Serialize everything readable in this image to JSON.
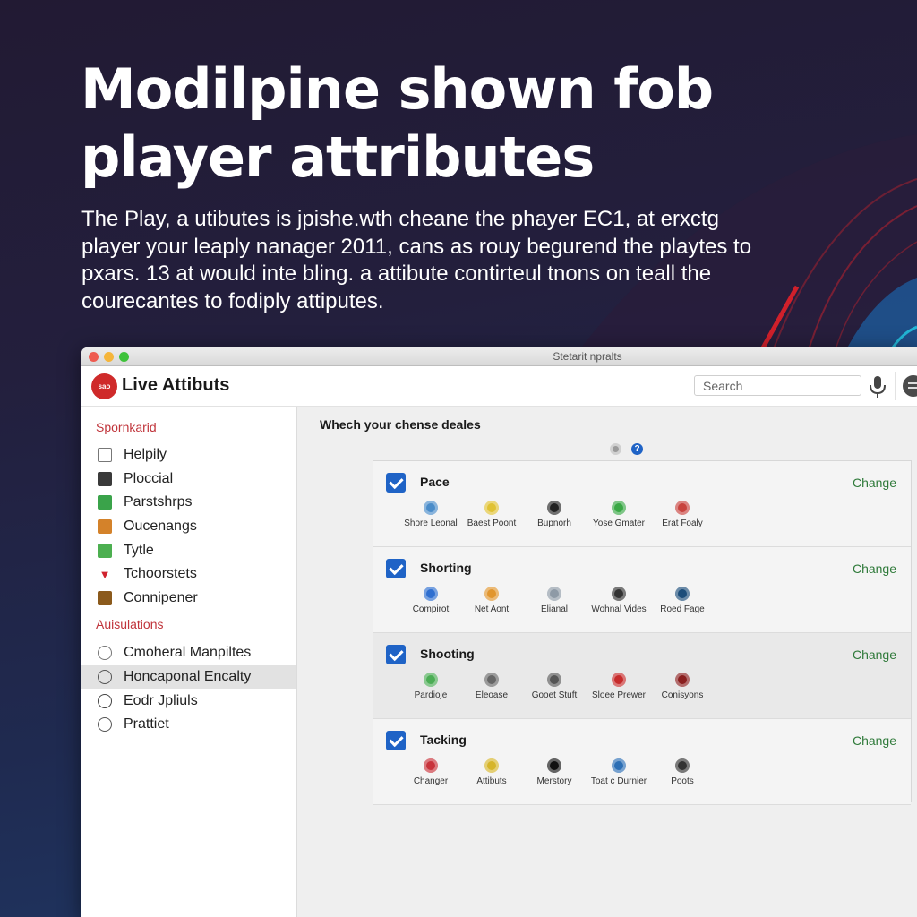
{
  "hero": {
    "headline_line1": "Modilpine shown fob",
    "headline_line2": "player attributes",
    "intro": "The Play, a utibutes is jpishe.wth cheane the phayer EC1, at erxctg player your leaply nanager 2011, cans as rouy begurend the playtes to pxars. 13 at would inte bling. a attibute contirteul tnons on teall the courecantes to fodiply attiputes."
  },
  "window": {
    "title": "Stetarit npralts",
    "app_name": "Live Attibuts",
    "logo_text": "sao",
    "search_placeholder": "Search",
    "icons": {
      "mic": "microphone-icon",
      "settings": "settings-icon"
    }
  },
  "sidebar": {
    "sections": [
      {
        "heading": "Spornkarid",
        "items": [
          {
            "label": "Helpily",
            "icon": "document-icon",
            "color": "#777777"
          },
          {
            "label": "Ploccial",
            "icon": "seat-icon",
            "color": "#3a3a3a"
          },
          {
            "label": "Parstshrps",
            "icon": "home-icon",
            "color": "#3aa34a"
          },
          {
            "label": "Oucenangs",
            "icon": "shield-icon",
            "color": "#d4822a"
          },
          {
            "label": "Tytle",
            "icon": "chart-icon",
            "color": "#4caf50"
          },
          {
            "label": "Tchoorstets",
            "icon": "check-mark-icon",
            "color": "#d0232f"
          },
          {
            "label": "Connipener",
            "icon": "triangle-icon",
            "color": "#8b5a1c"
          }
        ]
      },
      {
        "heading": "Auisulations",
        "items": [
          {
            "label": "Cmoheral Manpiltes",
            "icon": "user-icon",
            "color": "#777777",
            "active": false
          },
          {
            "label": "Honcaponal Encalty",
            "icon": "columns-icon",
            "color": "#555555",
            "active": true
          },
          {
            "label": "Eodr Jpliuls",
            "icon": "location-icon",
            "color": "#444444",
            "active": false
          },
          {
            "label": "Prattiet",
            "icon": "house-icon",
            "color": "#555555",
            "active": false
          }
        ]
      }
    ]
  },
  "main": {
    "title": "Whech your chense deales",
    "toolbar_icons": [
      "refresh-icon",
      "help-icon"
    ],
    "change_label": "Change",
    "cards": [
      {
        "title": "Pace",
        "checked": true,
        "attributes": [
          {
            "label": "Shore Leonal",
            "color": "#4a8cc9"
          },
          {
            "label": "Baest Poont",
            "color": "#e0c233"
          },
          {
            "label": "Bupnorh",
            "color": "#222222"
          },
          {
            "label": "Yose Gmater",
            "color": "#3aa845"
          },
          {
            "label": "Erat Foaly",
            "color": "#c8433e"
          }
        ]
      },
      {
        "title": "Shorting",
        "checked": true,
        "attributes": [
          {
            "label": "Compirot",
            "color": "#2f6fd0"
          },
          {
            "label": "Net Aont",
            "color": "#e1962f"
          },
          {
            "label": "Elianal",
            "color": "#8e9aa6"
          },
          {
            "label": "Wohnal Vides",
            "color": "#333333"
          },
          {
            "label": "Roed Fage",
            "color": "#1c4d7a"
          }
        ]
      },
      {
        "title": "Shooting",
        "checked": true,
        "attributes": [
          {
            "label": "Pardioje",
            "color": "#4cad55"
          },
          {
            "label": "Eleoase",
            "color": "#666666"
          },
          {
            "label": "Gooet Stuft",
            "color": "#555555"
          },
          {
            "label": "Sloee Prewer",
            "color": "#c62b2b"
          },
          {
            "label": "Conisyons",
            "color": "#8a1f1f"
          }
        ]
      },
      {
        "title": "Tacking",
        "checked": true,
        "attributes": [
          {
            "label": "Changer",
            "color": "#c8333b"
          },
          {
            "label": "Attibuts",
            "color": "#d6b52a"
          },
          {
            "label": "Merstory",
            "color": "#111111"
          },
          {
            "label": "Toat c Durnier",
            "color": "#2d6fb5"
          },
          {
            "label": "Poots",
            "color": "#333333"
          }
        ]
      }
    ]
  },
  "colors": {
    "accent_red": "#c0343b",
    "check_blue": "#1f63c6",
    "change_green": "#2f7a3a"
  }
}
